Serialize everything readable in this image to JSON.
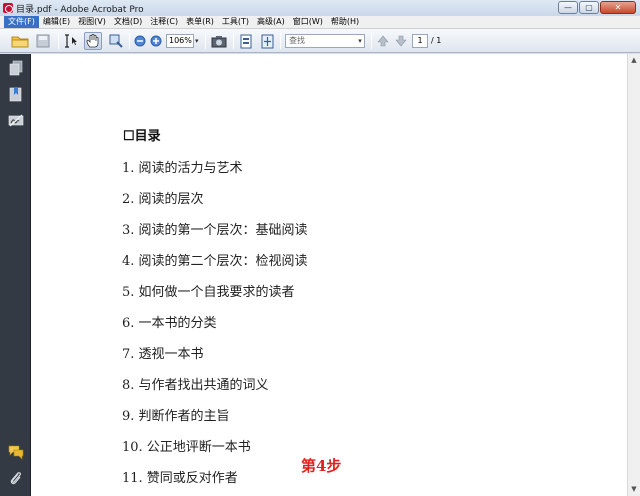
{
  "window": {
    "title": "目录.pdf - Adobe Acrobat Pro",
    "buttons": {
      "minimize": "—",
      "maximize": "▢",
      "close": "✕"
    }
  },
  "menu": [
    {
      "label": "文件(F)",
      "active": true
    },
    {
      "label": "编辑(E)"
    },
    {
      "label": "视图(V)"
    },
    {
      "label": "文档(D)"
    },
    {
      "label": "注释(C)"
    },
    {
      "label": "表单(R)"
    },
    {
      "label": "工具(T)"
    },
    {
      "label": "高级(A)"
    },
    {
      "label": "窗口(W)"
    },
    {
      "label": "帮助(H)"
    }
  ],
  "toolbar": {
    "zoom_value": "106%",
    "find_placeholder": "查找",
    "current_page": "1",
    "total_pages": "/ 1"
  },
  "document": {
    "heading": "☐目录",
    "items": [
      "1. 阅读的活力与艺术",
      "2. 阅读的层次",
      "3. 阅读的第一个层次：基础阅读",
      "4. 阅读的第二个层次：检视阅读",
      "5. 如何做一个自我要求的读者",
      "6. 一本书的分类",
      "7. 透视一本书",
      "8. 与作者找出共通的词义",
      "9. 判断作者的主旨",
      "10. 公正地评断一本书",
      "11. 赞同或反对作者"
    ],
    "step_label": "第4步"
  },
  "colors": {
    "accent": "#3a6fc7",
    "step_label": "#e0221f",
    "nav_panel": "#333a44"
  }
}
